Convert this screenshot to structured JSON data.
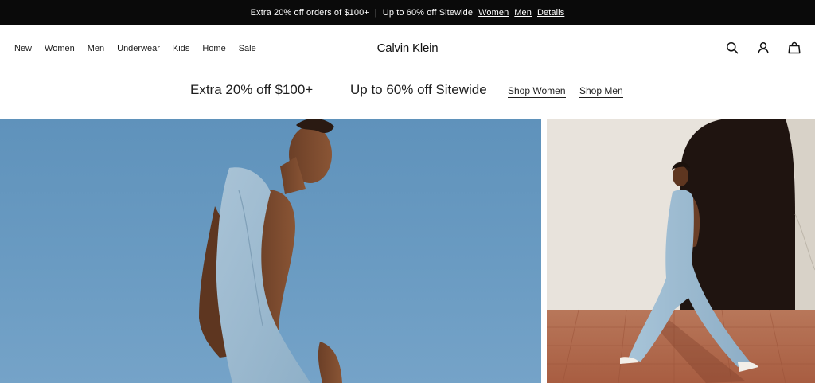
{
  "announcement": {
    "text_1": "Extra 20% off orders of $100+",
    "separator": "|",
    "text_2": "Up to 60% off Sitewide",
    "link_women": "Women",
    "link_men": "Men",
    "link_details": "Details"
  },
  "nav": {
    "items": [
      {
        "label": "New"
      },
      {
        "label": "Women"
      },
      {
        "label": "Men"
      },
      {
        "label": "Underwear"
      },
      {
        "label": "Kids"
      },
      {
        "label": "Home"
      },
      {
        "label": "Sale"
      }
    ]
  },
  "brand": {
    "logo": "Calvin Klein"
  },
  "header_icons": [
    "search-icon",
    "account-icon",
    "bag-icon"
  ],
  "promo": {
    "offer_1": "Extra 20% off $100+",
    "offer_2": "Up to 60% off Sitewide",
    "cta_women": "Shop Women",
    "cta_men": "Shop Men"
  },
  "colors": {
    "announcement_bg": "#0a0a0a",
    "hero_sky": "#6a9bc2",
    "hero_right_wall": "#e9e5df",
    "terracotta": "#b5684a"
  }
}
